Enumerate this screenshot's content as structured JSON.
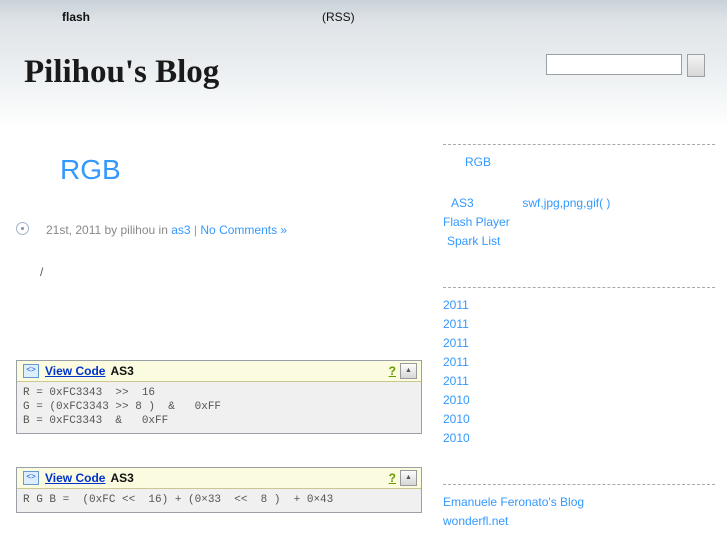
{
  "header": {
    "nav": [
      {
        "label": "flash",
        "name": "topnav-flash"
      },
      {
        "label": "(RSS)",
        "name": "topnav-rss"
      }
    ],
    "blog_title": "Pilihou's Blog",
    "search": {
      "value": "",
      "placeholder": "",
      "submit_label": ""
    }
  },
  "post": {
    "title": "RGB",
    "meta": {
      "date": "21st, 2011 by pilihou in",
      "category": "as3",
      "separator": "|",
      "comments": "No Comments »"
    },
    "body_text": "/",
    "code_blocks": [
      {
        "icon": "<>",
        "view_label": "View Code",
        "language": "AS3",
        "help_label": "?",
        "collapse_label": "▲",
        "code": "R = 0xFC3343  >>  16\nG = (0xFC3343 >> 8 )  &   0xFF\nB = 0xFC3343  &   0xFF"
      },
      {
        "icon": "<>",
        "view_label": "View Code",
        "language": "AS3",
        "help_label": "?",
        "collapse_label": "▲",
        "code": "R G B =  (0xFC <<  16) + (0×33  <<  8 )  + 0×43"
      }
    ]
  },
  "sidebar": {
    "recent_posts": [
      {
        "label": "RGB"
      }
    ],
    "categories": [
      {
        "label": "AS3"
      },
      {
        "label": "swf,jpg,png,gif(  )"
      },
      {
        "label": "Flash Player"
      },
      {
        "label": "Spark List"
      }
    ],
    "archives": [
      {
        "label": "2011"
      },
      {
        "label": "2011"
      },
      {
        "label": "2011"
      },
      {
        "label": "2011"
      },
      {
        "label": "2011"
      },
      {
        "label": "2010"
      },
      {
        "label": "2010"
      },
      {
        "label": "2010"
      }
    ],
    "blogroll": [
      {
        "label": "Emanuele Feronato's Blog"
      },
      {
        "label": "wonderfl.net"
      }
    ]
  },
  "colors": {
    "link": "#3399ff",
    "title": "#1a1a1a",
    "code_link": "#0033cc",
    "help": "#669900",
    "toolbar_bg": "#fbfbdf",
    "code_bg": "#f0f0f0"
  }
}
